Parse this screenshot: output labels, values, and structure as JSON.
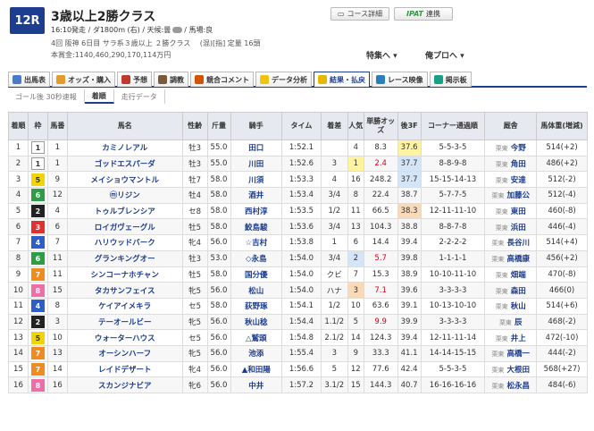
{
  "race": {
    "number": "12R",
    "title": "3歳以上2勝クラス",
    "info1_time": "16:10発走 / ダ1800m (右) / 天候:曇",
    "info1_track": "/ 馬場:良",
    "info2": "4回 阪神 6日目 サラ系３歳以上 ２勝クラス　 (混)[指] 定量 16頭",
    "info3": "本賞金:1140,460,290,170,114万円",
    "course_btn": "コース詳細",
    "ipat_logo": "IPAT",
    "ipat_btn": "連携",
    "tokushu": "特集へ ▾",
    "ore": "俺プロへ ▾"
  },
  "tabs": [
    {
      "label": "出馬表",
      "color": "#4a7bc8"
    },
    {
      "label": "オッズ・購入",
      "color": "#e39c2b"
    },
    {
      "label": "予想",
      "color": "#c0392b"
    },
    {
      "label": "調教",
      "color": "#7a5a3a"
    },
    {
      "label": "競合コメント",
      "color": "#d35400"
    },
    {
      "label": "データ分析",
      "color": "#f1c40f"
    },
    {
      "label": "結果・払戻",
      "color": "#e6b800"
    },
    {
      "label": "レース映像",
      "color": "#2980b9"
    },
    {
      "label": "掲示板",
      "color": "#16a085"
    }
  ],
  "subtabs": [
    "ゴール後 30秒速報",
    "着順",
    "走行データ"
  ],
  "columns": [
    "着順",
    "枠",
    "馬番",
    "馬名",
    "性齢",
    "斤量",
    "騎手",
    "タイム",
    "着差",
    "人気",
    "単勝オッズ",
    "後3F",
    "コーナー通過順",
    "厩舎",
    "馬体重(増減)"
  ],
  "waku_colors": {
    "1": {
      "bg": "#ffffff",
      "fg": "#333333",
      "border": "#999999"
    },
    "2": {
      "bg": "#222222",
      "fg": "#ffffff",
      "border": "#222222"
    },
    "3": {
      "bg": "#e03030",
      "fg": "#ffffff",
      "border": "#e03030"
    },
    "4": {
      "bg": "#2e5fc8",
      "fg": "#ffffff",
      "border": "#2e5fc8"
    },
    "5": {
      "bg": "#f2d400",
      "fg": "#333333",
      "border": "#f2d400"
    },
    "6": {
      "bg": "#2e9e46",
      "fg": "#ffffff",
      "border": "#2e9e46"
    },
    "7": {
      "bg": "#f08c1e",
      "fg": "#ffffff",
      "border": "#f08c1e"
    },
    "8": {
      "bg": "#f06ea8",
      "fg": "#ffffff",
      "border": "#f06ea8"
    }
  },
  "rows": [
    {
      "rank": "1",
      "waku": "1",
      "num": "1",
      "name": "カミノレアル",
      "sex": "牡3",
      "weight": "55.0",
      "jockey": "田口",
      "time": "1:52.1",
      "margin": "",
      "pop": "4",
      "odds": "8.3",
      "last3f": "37.6",
      "f3": 1,
      "corner": "5-5-3-5",
      "aff": "栗東",
      "trainer": "今野",
      "body": "514(+2)",
      "hot": false
    },
    {
      "rank": "2",
      "waku": "1",
      "num": "1",
      "name": "ゴッドエスパーダ",
      "sex": "牡3",
      "weight": "55.0",
      "jockey": "川田",
      "time": "1:52.6",
      "margin": "3",
      "pop": "1",
      "odds": "2.4",
      "last3f": "37.7",
      "f3": 2,
      "corner": "8-8-9-8",
      "aff": "栗東",
      "trainer": "角田",
      "body": "486(+2)",
      "hot": true
    },
    {
      "rank": "3",
      "waku": "5",
      "num": "9",
      "name": "メイショウマントル",
      "sex": "牡7",
      "weight": "58.0",
      "jockey": "川須",
      "time": "1:53.3",
      "margin": "4",
      "pop": "16",
      "odds": "248.2",
      "last3f": "37.7",
      "f3": 2,
      "corner": "15-15-14-13",
      "aff": "栗東",
      "trainer": "安達",
      "body": "512(-2)",
      "hot": false
    },
    {
      "rank": "4",
      "waku": "6",
      "num": "12",
      "name": "ⓜリジン",
      "sex": "牡4",
      "weight": "58.0",
      "jockey": "酒井",
      "time": "1:53.4",
      "margin": "3/4",
      "pop": "8",
      "odds": "22.4",
      "last3f": "38.7",
      "f3": 0,
      "corner": "5-7-7-5",
      "aff": "栗東",
      "trainer": "加藤公",
      "body": "512(-4)",
      "hot": false
    },
    {
      "rank": "5",
      "waku": "2",
      "num": "4",
      "name": "トゥルブレンシア",
      "sex": "セ8",
      "weight": "58.0",
      "jockey": "西村淳",
      "time": "1:53.5",
      "margin": "1/2",
      "pop": "11",
      "odds": "66.5",
      "last3f": "38.3",
      "f3": 3,
      "corner": "12-11-11-10",
      "aff": "栗東",
      "trainer": "東田",
      "body": "460(-8)",
      "hot": false
    },
    {
      "rank": "6",
      "waku": "3",
      "num": "6",
      "name": "ロイガヴェーグル",
      "sex": "牡5",
      "weight": "58.0",
      "jockey": "鮫島駿",
      "time": "1:53.6",
      "margin": "3/4",
      "pop": "13",
      "odds": "104.3",
      "last3f": "38.8",
      "f3": 0,
      "corner": "8-8-7-8",
      "aff": "栗東",
      "trainer": "浜田",
      "body": "446(-4)",
      "hot": false
    },
    {
      "rank": "7",
      "waku": "4",
      "num": "7",
      "name": "ハリウッドバーク",
      "sex": "牝4",
      "weight": "56.0",
      "jockey": "☆吉村",
      "time": "1:53.8",
      "margin": "1",
      "pop": "6",
      "odds": "14.4",
      "last3f": "39.4",
      "f3": 0,
      "corner": "2-2-2-2",
      "aff": "栗東",
      "trainer": "長谷川",
      "body": "514(+4)",
      "hot": false
    },
    {
      "rank": "8",
      "waku": "6",
      "num": "11",
      "name": "グランキングオー",
      "sex": "牡3",
      "weight": "53.0",
      "jockey": "◇永島",
      "time": "1:54.0",
      "margin": "3/4",
      "pop": "2",
      "odds": "5.7",
      "last3f": "39.8",
      "f3": 0,
      "corner": "1-1-1-1",
      "aff": "栗東",
      "trainer": "高橋康",
      "body": "456(+2)",
      "hot": true
    },
    {
      "rank": "9",
      "waku": "7",
      "num": "11",
      "name": "シンコーナホチャン",
      "sex": "牡5",
      "weight": "58.0",
      "jockey": "国分優",
      "time": "1:54.0",
      "margin": "クビ",
      "pop": "7",
      "odds": "15.3",
      "last3f": "38.9",
      "f3": 0,
      "corner": "10-10-11-10",
      "aff": "栗東",
      "trainer": "畑端",
      "body": "470(-8)",
      "hot": false
    },
    {
      "rank": "10",
      "waku": "8",
      "num": "15",
      "name": "タカサンフェイス",
      "sex": "牝5",
      "weight": "56.0",
      "jockey": "松山",
      "time": "1:54.0",
      "margin": "ハナ",
      "pop": "3",
      "odds": "7.1",
      "last3f": "39.6",
      "f3": 0,
      "corner": "3-3-3-3",
      "aff": "栗東",
      "trainer": "森田",
      "body": "466(0)",
      "hot": true
    },
    {
      "rank": "11",
      "waku": "4",
      "num": "8",
      "name": "ケイアイメキラ",
      "sex": "セ5",
      "weight": "58.0",
      "jockey": "荻野琢",
      "time": "1:54.1",
      "margin": "1/2",
      "pop": "10",
      "odds": "63.6",
      "last3f": "39.1",
      "f3": 0,
      "corner": "10-13-10-10",
      "aff": "栗東",
      "trainer": "秋山",
      "body": "514(+6)",
      "hot": false
    },
    {
      "rank": "12",
      "waku": "2",
      "num": "3",
      "name": "テーオールビー",
      "sex": "牝5",
      "weight": "56.0",
      "jockey": "秋山稔",
      "time": "1:54.4",
      "margin": "1.1/2",
      "pop": "5",
      "odds": "9.9",
      "last3f": "39.9",
      "f3": 0,
      "corner": "3-3-3-3",
      "aff": "栗東",
      "trainer": "辰",
      "body": "468(-2)",
      "hot": true
    },
    {
      "rank": "13",
      "waku": "5",
      "num": "10",
      "name": "ウォーターハウス",
      "sex": "セ5",
      "weight": "56.0",
      "jockey": "△鷲頭",
      "time": "1:54.8",
      "margin": "2.1/2",
      "pop": "14",
      "odds": "124.3",
      "last3f": "39.4",
      "f3": 0,
      "corner": "12-11-11-14",
      "aff": "栗東",
      "trainer": "井上",
      "body": "472(-10)",
      "hot": false
    },
    {
      "rank": "14",
      "waku": "7",
      "num": "13",
      "name": "オーシンハーフ",
      "sex": "牝5",
      "weight": "56.0",
      "jockey": "池添",
      "time": "1:55.4",
      "margin": "3",
      "pop": "9",
      "odds": "33.3",
      "last3f": "41.1",
      "f3": 0,
      "corner": "14-14-15-15",
      "aff": "栗東",
      "trainer": "高橋一",
      "body": "444(-2)",
      "hot": false
    },
    {
      "rank": "15",
      "waku": "7",
      "num": "14",
      "name": "レイドデザート",
      "sex": "牝4",
      "weight": "56.0",
      "jockey": "▲和田陽",
      "time": "1:56.6",
      "margin": "5",
      "pop": "12",
      "odds": "77.6",
      "last3f": "42.4",
      "f3": 0,
      "corner": "5-5-3-5",
      "aff": "栗東",
      "trainer": "大根田",
      "body": "568(+27)",
      "hot": false
    },
    {
      "rank": "16",
      "waku": "8",
      "num": "16",
      "name": "スカンジナビア",
      "sex": "牝6",
      "weight": "56.0",
      "jockey": "中井",
      "time": "1:57.2",
      "margin": "3.1/2",
      "pop": "15",
      "odds": "144.3",
      "last3f": "40.7",
      "f3": 0,
      "corner": "16-16-16-16",
      "aff": "栗東",
      "trainer": "松永昌",
      "body": "484(-6)",
      "hot": false
    }
  ]
}
